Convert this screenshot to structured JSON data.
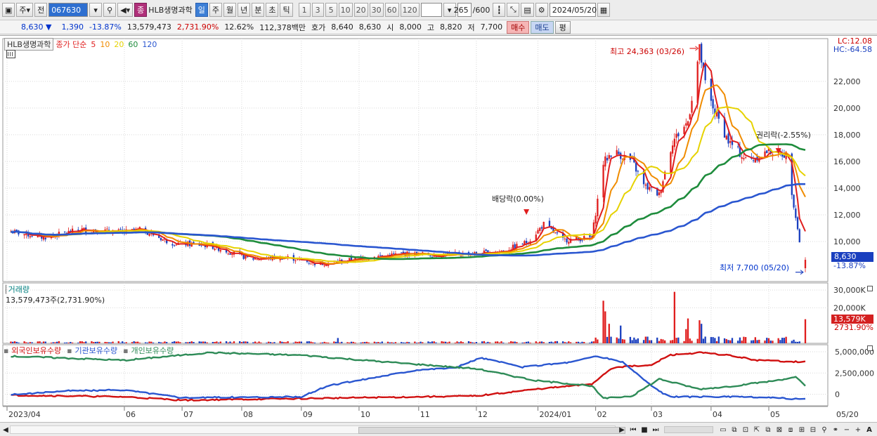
{
  "toolbar": {
    "type_select": "주",
    "prev_label": "전",
    "code": "067630",
    "mode_badge": "종",
    "stock_name": "HLB생명과학",
    "periods": [
      "일",
      "주",
      "월",
      "년",
      "분",
      "초",
      "틱"
    ],
    "active_period": "일",
    "intervals": [
      "1",
      "3",
      "5",
      "10",
      "20",
      "30",
      "60",
      "120"
    ],
    "count": "265",
    "count_total": "/600",
    "date": "2024/05/20"
  },
  "quote": {
    "price": "8,630",
    "price_arrow": "▼",
    "change": "1,390",
    "change_pct": "-13.87%",
    "volume": "13,579,473",
    "volume_pct": "2,731.90%",
    "turnover": "12.62%",
    "amount": "112,378백만",
    "bid_label": "호가",
    "bid1": "8,640",
    "bid2": "8,630",
    "open_label": "시",
    "open": "8,000",
    "high_label": "고",
    "high": "8,820",
    "low_label": "저",
    "low": "7,700",
    "buy_label": "매수",
    "sell_label": "매도",
    "eval_label": "평"
  },
  "legend": {
    "name": "HLB생명과학",
    "ma_title": "종가 단순",
    "ma_periods": [
      {
        "period": "5",
        "color": "#e01e1e"
      },
      {
        "period": "10",
        "color": "#f08c00"
      },
      {
        "period": "20",
        "color": "#e6d200"
      },
      {
        "period": "60",
        "color": "#1e8c3c"
      },
      {
        "period": "120",
        "color": "#2a56d0"
      }
    ]
  },
  "right_info": {
    "lc": "LC:12.08",
    "hc": "HC:-64.58"
  },
  "annotations": {
    "high": "최고 24,363 (03/26)",
    "low": "최저 7,700 (05/20)",
    "dividend": "배당락(0.00%)",
    "rights": "권리락(-2.55%)"
  },
  "price_tag": {
    "price": "8,630",
    "pct": "-13.87%"
  },
  "volume_panel": {
    "title": "거래량",
    "summary": "13,579,473주(2,731.90%)",
    "tag": "13,579K",
    "tag_pct": "2731.90%"
  },
  "investor_panel": {
    "series": [
      {
        "name": "외국인보유수량",
        "color": "#d01010"
      },
      {
        "name": "기관보유수량",
        "color": "#2a56d0"
      },
      {
        "name": "개인보유수량",
        "color": "#2e8b57"
      }
    ]
  },
  "colors": {
    "up": "#e01e1e",
    "down": "#1a3fbf",
    "grid": "#d9d9d9"
  },
  "chart_data": {
    "type": "candlestick",
    "price_axis": {
      "ticks": [
        10000,
        12000,
        14000,
        16000,
        18000,
        20000,
        22000
      ],
      "ylim": [
        7000,
        25200
      ]
    },
    "volume_axis": {
      "ticks": [
        "30,000K",
        "20,000K"
      ]
    },
    "holdings_axis": {
      "ticks": [
        "5,000,000",
        "2,500,000",
        "0"
      ]
    },
    "x_labels": [
      "2023/04",
      "06",
      "07",
      "08",
      "09",
      "10",
      "11",
      "12",
      "2024/01",
      "02",
      "03",
      "04",
      "05",
      "05/20"
    ],
    "close_path": [
      [
        "2023-04-01",
        10800
      ],
      [
        "2023-04-20",
        10300
      ],
      [
        "2023-05-10",
        10900
      ],
      [
        "2023-06-01",
        10700
      ],
      [
        "2023-06-10",
        10900
      ],
      [
        "2023-06-25",
        9900
      ],
      [
        "2023-07-15",
        9700
      ],
      [
        "2023-07-28",
        9100
      ],
      [
        "2023-08-05",
        8700
      ],
      [
        "2023-08-25",
        8800
      ],
      [
        "2023-09-10",
        8300
      ],
      [
        "2023-09-25",
        8600
      ],
      [
        "2023-10-05",
        8800
      ],
      [
        "2023-10-25",
        9100
      ],
      [
        "2023-11-10",
        9000
      ],
      [
        "2023-12-01",
        9100
      ],
      [
        "2023-12-15",
        9300
      ],
      [
        "2023-12-28",
        10000
      ],
      [
        "2024-01-05",
        11300
      ],
      [
        "2024-01-15",
        10100
      ],
      [
        "2024-01-30",
        10300
      ],
      [
        "2024-02-05",
        15900
      ],
      [
        "2024-02-10",
        16800
      ],
      [
        "2024-02-20",
        16000
      ],
      [
        "2024-02-26",
        14200
      ],
      [
        "2024-03-05",
        13500
      ],
      [
        "2024-03-12",
        17500
      ],
      [
        "2024-03-20",
        19000
      ],
      [
        "2024-03-26",
        24363
      ],
      [
        "2024-03-30",
        21000
      ],
      [
        "2024-04-10",
        17500
      ],
      [
        "2024-04-20",
        16000
      ],
      [
        "2024-05-01",
        16800
      ],
      [
        "2024-05-10",
        16500
      ],
      [
        "2024-05-17",
        10020
      ],
      [
        "2024-05-20",
        8630
      ]
    ],
    "high": {
      "value": 24363,
      "date": "03/26"
    },
    "low": {
      "value": 7700,
      "date": "05/20"
    },
    "last_volume": 13579473
  }
}
